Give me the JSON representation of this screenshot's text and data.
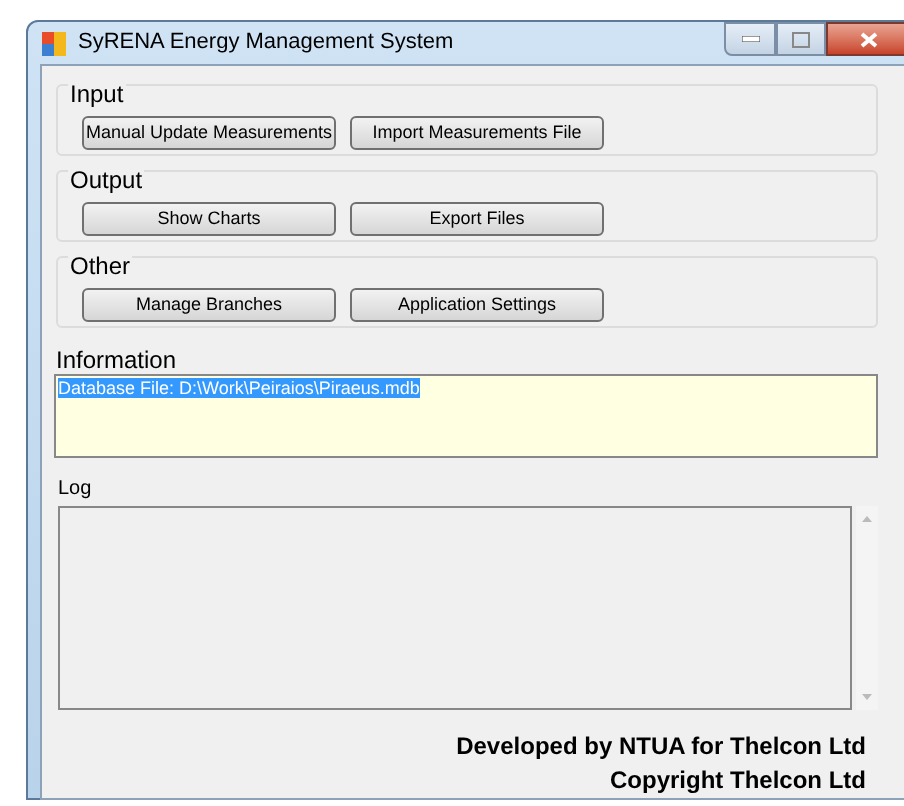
{
  "window": {
    "title": "SyRENA Energy Management System"
  },
  "groups": [
    {
      "title": "Input",
      "buttons": [
        "Manual Update Measurements",
        "Import Measurements File"
      ]
    },
    {
      "title": "Output",
      "buttons": [
        "Show Charts",
        "Export Files"
      ]
    },
    {
      "title": "Other",
      "buttons": [
        "Manage Branches",
        "Application Settings"
      ]
    }
  ],
  "information": {
    "label": "Information",
    "value": "Database File: D:\\Work\\Peiraios\\Piraeus.mdb"
  },
  "log": {
    "label": "Log"
  },
  "footer": [
    "Developed by NTUA for Thelcon Ltd",
    "Copyright Thelcon Ltd"
  ]
}
